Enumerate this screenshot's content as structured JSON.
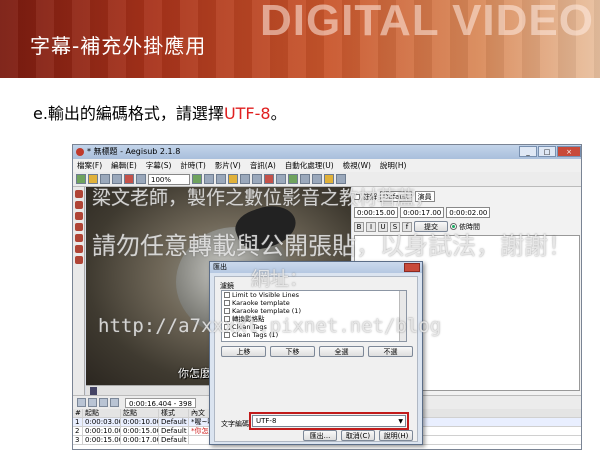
{
  "banner": {
    "title": "字幕-補充外掛應用",
    "brand": "DIGITAL VIDEO"
  },
  "instruction": {
    "prefix": "e.輸出的編碼格式，請選擇",
    "highlight": "UTF-8",
    "suffix": "。"
  },
  "app": {
    "title": "* 無標題 - Aegisub 2.1.8",
    "menu": [
      "檔案(F)",
      "編輯(E)",
      "字幕(S)",
      "計時(T)",
      "影片(V)",
      "音訊(A)",
      "自動化處理(U)",
      "檢視(W)",
      "說明(H)"
    ],
    "zoom": "100%",
    "playback_time": "0:00:16.404 - 398",
    "video_subtitle": "你怎麼都聽不懂",
    "edit": {
      "comment_label": "註解",
      "style": "Default",
      "actor_label": "演員",
      "start": "0:00:15.00",
      "end": "0:00:17.00",
      "duration": "0:00:02.00",
      "commit": "提交",
      "time_mode": "依時間"
    },
    "grid": {
      "headers": [
        "#",
        "起點",
        "訖點",
        "樣式",
        "內文"
      ],
      "rows": [
        {
          "n": "1",
          "start": "0:00:03.00",
          "end": "0:00:10.00",
          "style": "Default",
          "text": "*喔~喔~喔~"
        },
        {
          "n": "2",
          "start": "0:00:10.00",
          "end": "0:00:15.00",
          "style": "Default",
          "text": "*你怎麼都聽不懂我再叫什麼!!!!!!"
        },
        {
          "n": "3",
          "start": "0:00:15.00",
          "end": "0:00:17.00",
          "style": "Default",
          "text": ""
        }
      ]
    }
  },
  "dialog": {
    "title": "匯出",
    "filter_label": "濾鏡",
    "filters": [
      "Limit to Visible Lines",
      "Karaoke template",
      "Karaoke template (1)",
      "轉換影格點",
      "Clean Tags",
      "Clean Tags (1)"
    ],
    "buttons": [
      "上移",
      "下移",
      "全選",
      "不選"
    ],
    "encoding_label": "文字編碼",
    "encoding_value": "UTF-8",
    "actions": [
      "匯出...",
      "取消(C)",
      "說明(H)"
    ],
    "highlight_color": "#c21a1a"
  },
  "watermark": {
    "line1": "梁文老師，製作之數位影音之教材著蘆，",
    "line2": "請勿任意轉載與公開張貼，以身試法，謝謝！",
    "line3": "網址：",
    "line4": "http://a7xxxxl.pixnet.net/blog"
  }
}
